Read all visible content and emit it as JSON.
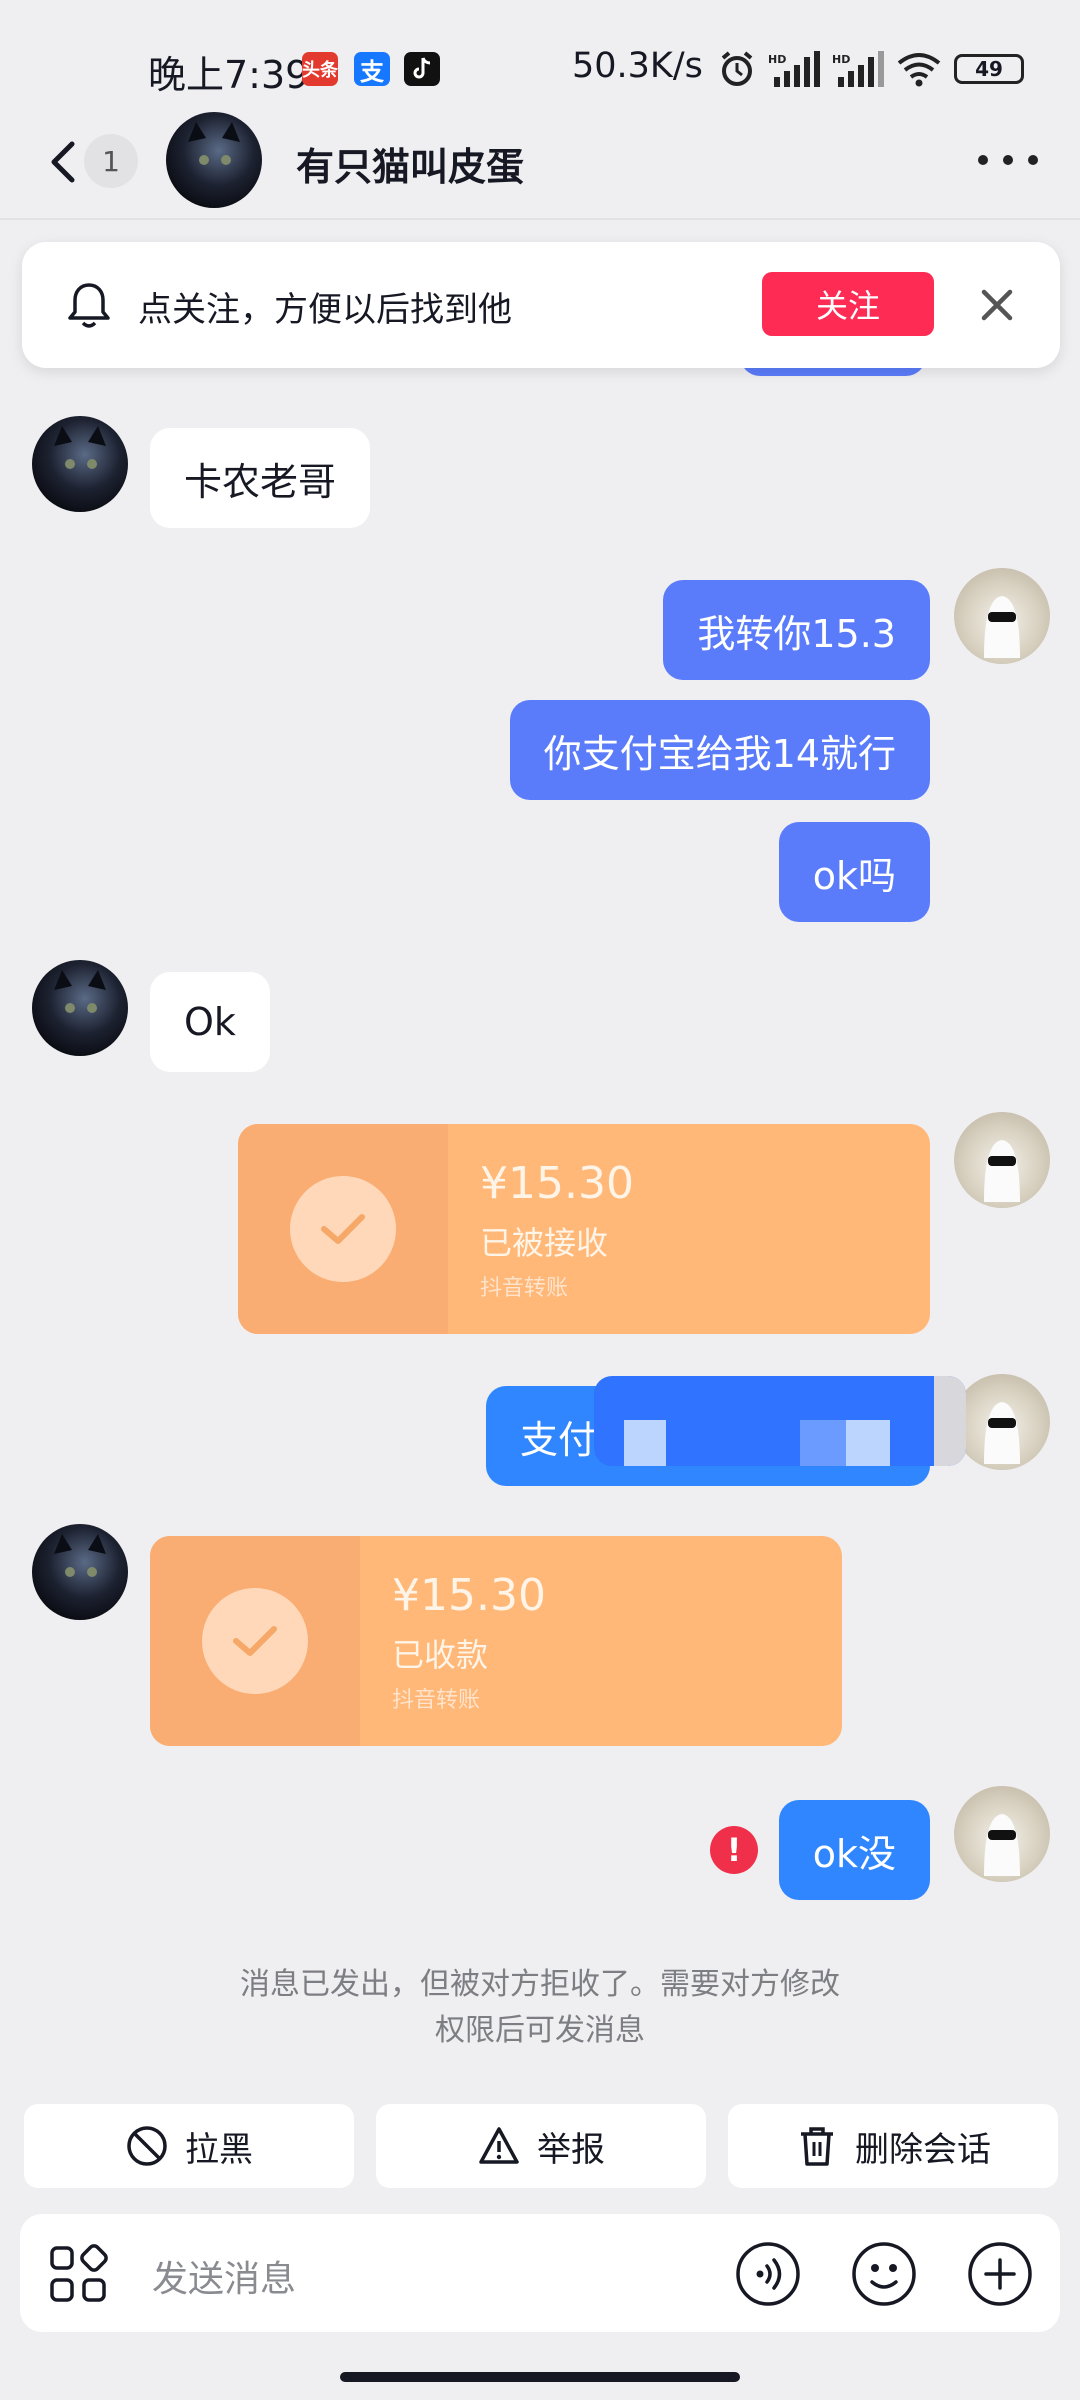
{
  "status_bar": {
    "time": "晚上7:39",
    "apps": [
      {
        "icon": "toutiao-icon",
        "label": "头条"
      },
      {
        "icon": "alipay-icon",
        "label": "支"
      },
      {
        "icon": "tiktok-icon",
        "label": ""
      }
    ],
    "net_speed": "50.3K/s",
    "battery": "49",
    "icons": [
      "alarm-icon",
      "signal-hd-icon",
      "signal-hd-icon",
      "wifi-icon",
      "battery-icon"
    ]
  },
  "header": {
    "unread_count": "1",
    "contact_name": "有只猫叫皮蛋"
  },
  "follow_banner": {
    "text": "点关注，方便以后找到他",
    "button": "关注"
  },
  "messages": [
    {
      "side": "in",
      "type": "text",
      "text": "卡农老哥"
    },
    {
      "side": "out",
      "type": "text",
      "text": "我转你15.3"
    },
    {
      "side": "out",
      "type": "text",
      "text": "你支付宝给我14就行"
    },
    {
      "side": "out",
      "type": "text",
      "text": "ok吗"
    },
    {
      "side": "in",
      "type": "text",
      "text": "Ok"
    },
    {
      "side": "out",
      "type": "transfer",
      "amount": "¥15.30",
      "status": "已被接收",
      "source": "抖音转账"
    },
    {
      "side": "out",
      "type": "text",
      "text": "支付",
      "partially_obscured": true
    },
    {
      "side": "in",
      "type": "transfer",
      "amount": "¥15.30",
      "status": "已收款",
      "source": "抖音转账"
    },
    {
      "side": "out",
      "type": "text",
      "text": "ok没",
      "failed": true,
      "error_mark": "!"
    }
  ],
  "notice": {
    "line1": "消息已发出，但被对方拒收了。需要对方修改",
    "line2": "权限后可发消息"
  },
  "actions": {
    "block": "拉黑",
    "report": "举报",
    "delete": "删除会话"
  },
  "input": {
    "placeholder": "发送消息"
  },
  "colors": {
    "follow_button": "#fe2c55",
    "out_bubble": "#5b7cfa",
    "out_bubble_latest": "#2f86ff",
    "transfer_card": "#ffb877",
    "error": "#f0304a",
    "background": "#efeff1"
  }
}
